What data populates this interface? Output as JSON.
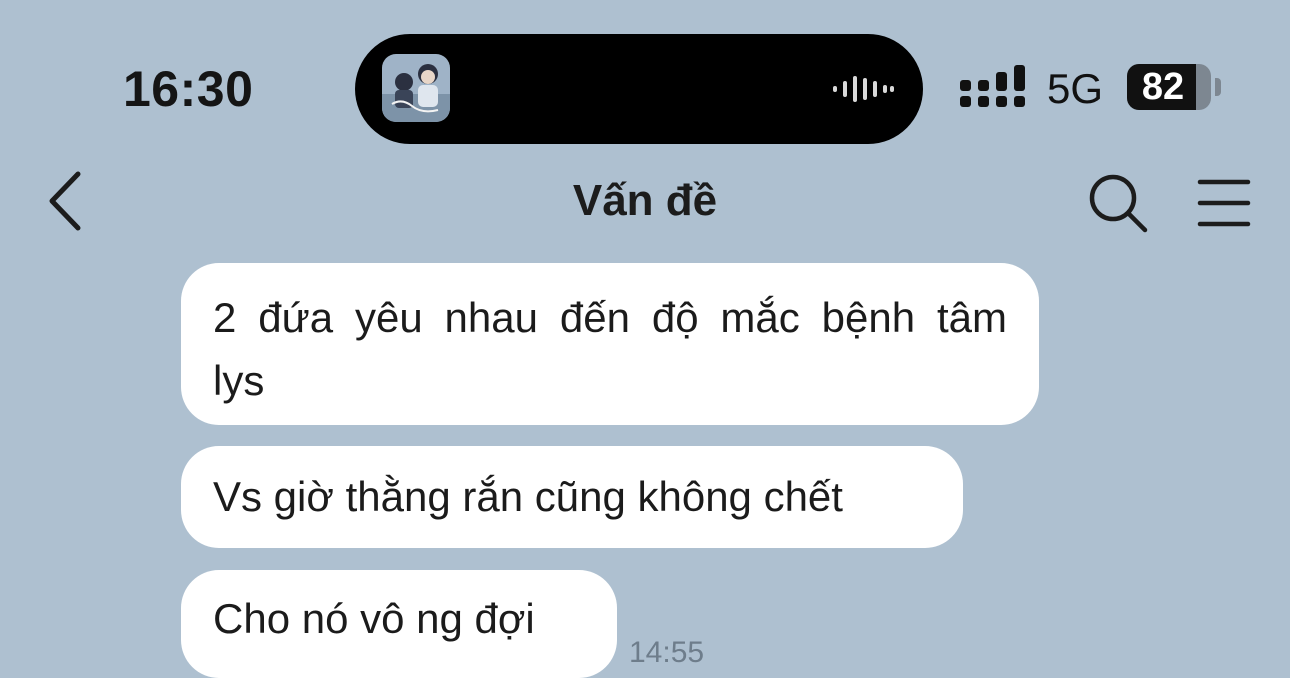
{
  "status_bar": {
    "time": "16:30",
    "network": "5G",
    "battery_level": "82",
    "battery_fraction": 0.82,
    "signal_icon": "signal-bars-icon",
    "media_icons": [
      "album-art",
      "waveform-icon"
    ]
  },
  "header": {
    "title": "Vấn đề",
    "back_icon": "chevron-left-icon",
    "search_icon": "search-icon",
    "menu_icon": "menu-icon"
  },
  "messages": [
    {
      "text": "2 đứa yêu nhau đến độ mắc bệnh tâm lys"
    },
    {
      "text": "Vs giờ thằng rắn cũng không chết"
    },
    {
      "text": "Cho nó vô ng đợi",
      "time": "14:55"
    }
  ],
  "colors": {
    "background": "#aec0d0",
    "bubble": "#ffffff",
    "text": "#1b1b1b",
    "timestamp": "#6e7d8b"
  }
}
